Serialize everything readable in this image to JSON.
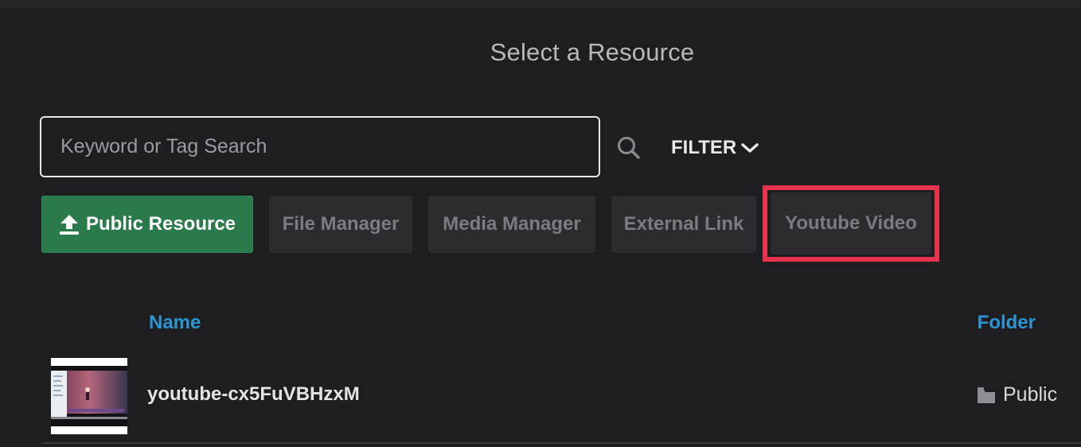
{
  "header": {
    "title": "Select a Resource"
  },
  "search": {
    "placeholder": "Keyword or Tag Search",
    "value": ""
  },
  "filter": {
    "label": "FILTER"
  },
  "sources": [
    {
      "label": "Public Resource",
      "active": true
    },
    {
      "label": "File Manager",
      "active": false
    },
    {
      "label": "Media Manager",
      "active": false
    },
    {
      "label": "External Link",
      "active": false
    },
    {
      "label": "Youtube Video",
      "active": false,
      "highlighted": true
    }
  ],
  "table": {
    "columns": {
      "name": "Name",
      "folder": "Folder"
    },
    "rows": [
      {
        "name": "youtube-cx5FuVBHzxM",
        "folder": "Public"
      }
    ]
  },
  "colors": {
    "background": "#1e1e20",
    "accent_green": "#2a7a4b",
    "link_blue": "#2b95d3",
    "highlight_red": "#e8334f"
  },
  "icons": {
    "search": "search-icon",
    "filter_chevron": "chevron-down-icon",
    "upload": "upload-icon",
    "folder": "folder-icon"
  }
}
